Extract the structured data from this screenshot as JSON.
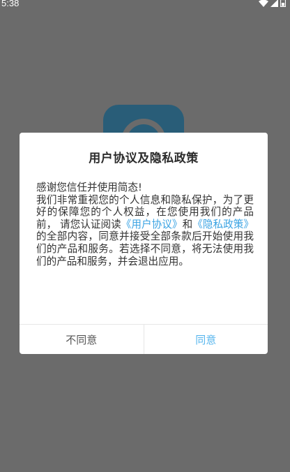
{
  "status_bar": {
    "time": "5:38",
    "icons": [
      "wifi-icon",
      "signal-icon",
      "battery-icon"
    ]
  },
  "dialog": {
    "title": "用户协议及隐私政策",
    "greeting": "感谢您信任并使用简态!",
    "body_part1": "我们非常重视您的个人信息和隐私保护，为了更好的保障您的个人权益，在您使用我们的产品前， 请您认证阅读",
    "user_agreement_link": "《用户协议》",
    "and_text": "和",
    "privacy_policy_link": "《隐私政策》",
    "body_part2": "的全部内容，同意并接受全部条款后开始使用我们的产品和服务。若选择不同意，将无法使用我们的产品和服务，并会退出应用。",
    "disagree_label": "不同意",
    "agree_label": "同意"
  },
  "colors": {
    "overlay": "#6b6b6b",
    "link": "#3aa3e3",
    "agree": "#57b6ee",
    "logo": "#295d78"
  }
}
